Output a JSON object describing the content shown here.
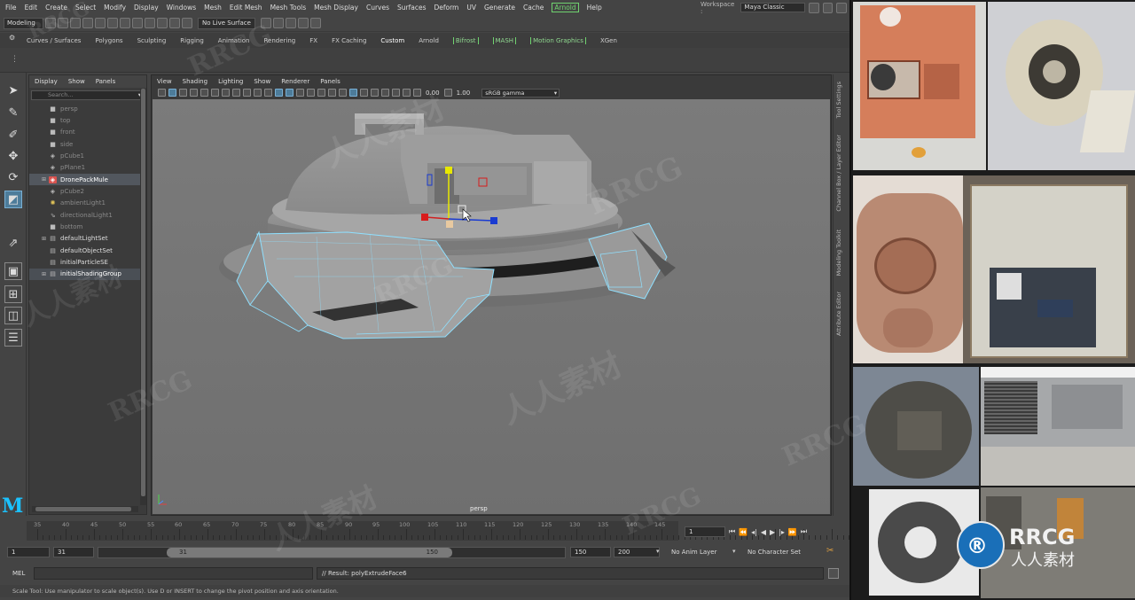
{
  "menubar": {
    "items": [
      "File",
      "Edit",
      "Create",
      "Select",
      "Modify",
      "Display",
      "Windows",
      "Mesh",
      "Edit Mesh",
      "Mesh Tools",
      "Mesh Display",
      "Curves",
      "Surfaces",
      "Deform",
      "UV",
      "Generate",
      "Cache",
      "Arnold",
      "Help"
    ],
    "workspace_label": "Workspace :",
    "workspace_value": "Maya Classic"
  },
  "statusline": {
    "mode": "Modeling",
    "live_surface": "No Live Surface"
  },
  "shelf_tabs": [
    "Curves / Surfaces",
    "Polygons",
    "Sculpting",
    "Rigging",
    "Animation",
    "Rendering",
    "FX",
    "FX Caching",
    "Custom",
    "Arnold",
    "Bifrost",
    "MASH",
    "Motion Graphics",
    "XGen"
  ],
  "outliner": {
    "menu": [
      "Display",
      "Show",
      "Panels"
    ],
    "search_placeholder": "Search...",
    "items": [
      "persp",
      "top",
      "front",
      "side",
      "pCube1",
      "pPlane1",
      "DronePackMule",
      "pCube2",
      "ambientLight1",
      "directionalLight1",
      "bottom",
      "defaultLightSet",
      "defaultObjectSet",
      "initialParticleSE",
      "initialShadingGroup"
    ]
  },
  "viewport": {
    "menu": [
      "View",
      "Shading",
      "Lighting",
      "Show",
      "Renderer",
      "Panels"
    ],
    "exposure": "0.00",
    "gamma_value": "1.00",
    "color_space": "sRGB gamma",
    "camera_label": "persp"
  },
  "right_tabs": [
    "Tool Settings",
    "Channel Box / Layer Editor",
    "Modeling Toolkit",
    "Attribute Editor"
  ],
  "timeline": {
    "ticks": [
      "35",
      "40",
      "45",
      "50",
      "55",
      "60",
      "65",
      "70",
      "75",
      "80",
      "85",
      "90",
      "95",
      "100",
      "105",
      "110",
      "115",
      "120",
      "125",
      "130",
      "135",
      "140",
      "145"
    ],
    "current_frame": "1"
  },
  "range": {
    "start": "1",
    "range_start": "31",
    "slider_start": "31",
    "slider_end": "150",
    "range_end": "150",
    "end": "200",
    "anim_layer": "No Anim Layer",
    "character_set": "No Character Set"
  },
  "command": {
    "lang": "MEL",
    "result": "// Result: polyExtrudeFace6"
  },
  "help_line": "Scale Tool: Use manipulator to scale object(s). Use D or INSERT to change the pivot position and axis orientation.",
  "watermark": {
    "latin": "RRCG",
    "cjk": "人人素材"
  },
  "colors": {
    "bg": "#444444",
    "selection": "#52575e",
    "accent_green": "#6fd36f",
    "maya_blue": "#1bc2ff",
    "wire_highlight": "#8fe0ff"
  }
}
